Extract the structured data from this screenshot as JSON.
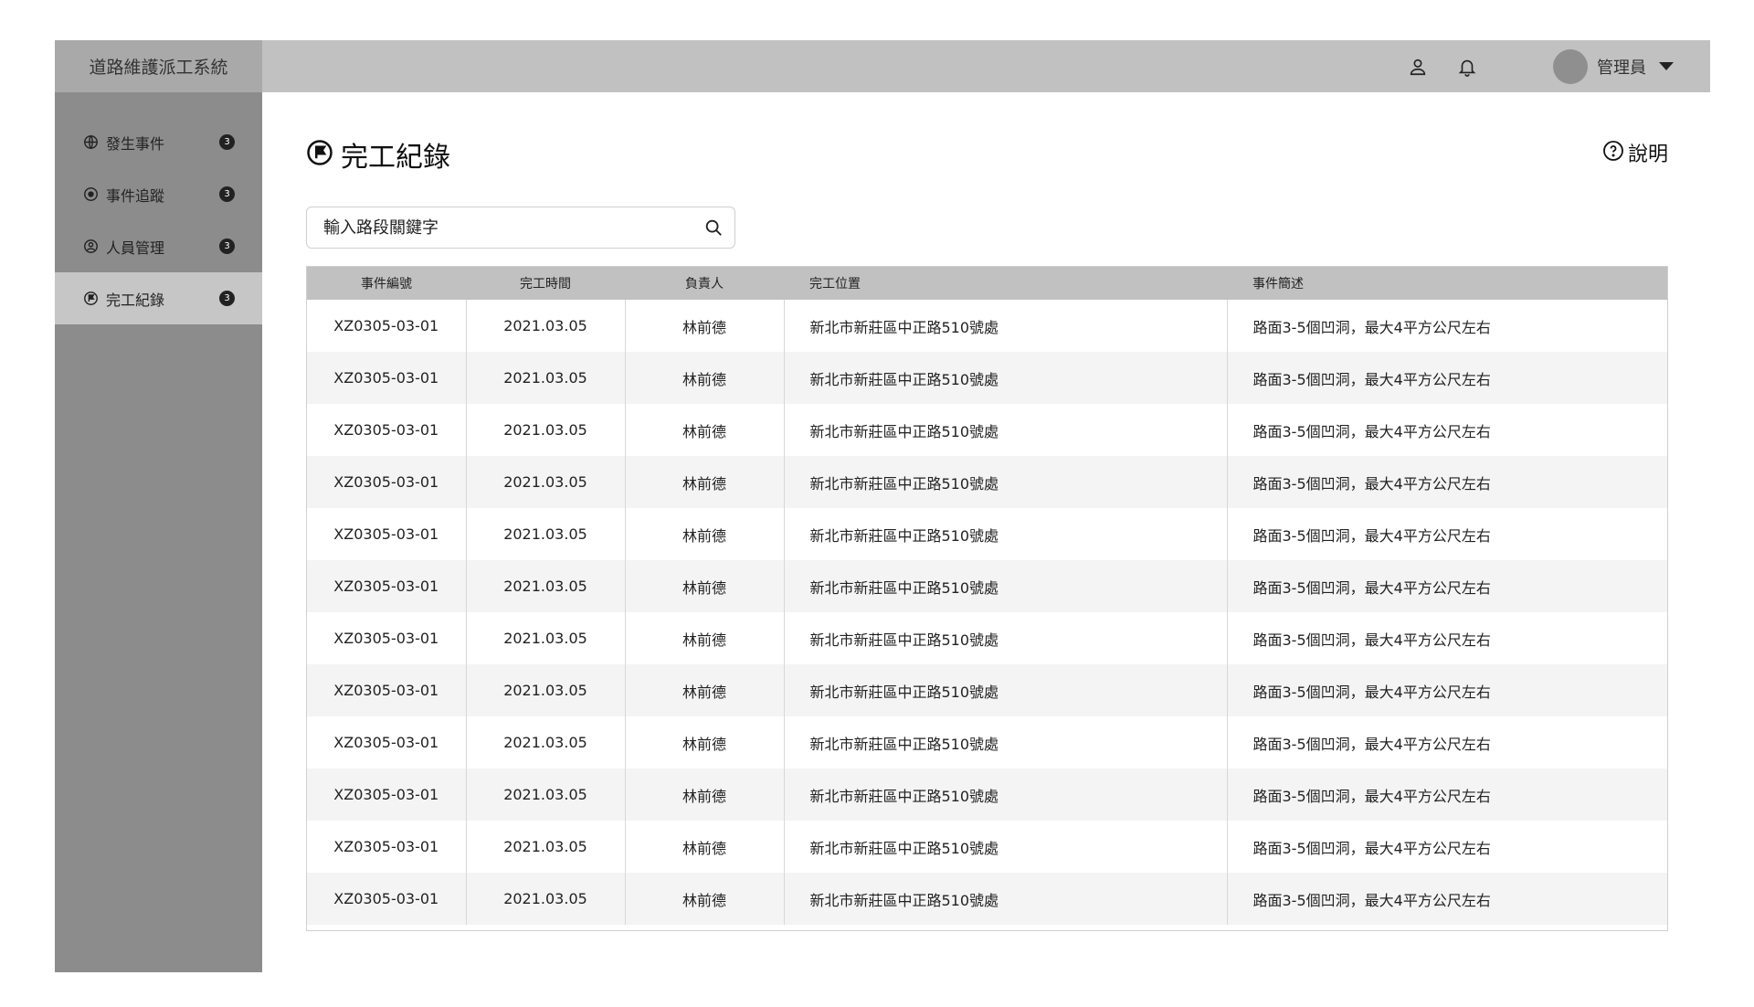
{
  "app": {
    "title": "道路維護派工系統"
  },
  "header": {
    "user_name": "管理員",
    "icons": [
      "user-icon",
      "bell-icon",
      "chevron-down-icon"
    ]
  },
  "sidebar": {
    "items": [
      {
        "label": "發生事件",
        "badge": "3",
        "icon": "globe-icon",
        "active": false
      },
      {
        "label": "事件追蹤",
        "badge": "3",
        "icon": "eye-icon",
        "active": false
      },
      {
        "label": "人員管理",
        "badge": "3",
        "icon": "person-circle-icon",
        "active": false
      },
      {
        "label": "完工紀錄",
        "badge": "3",
        "icon": "flag-circle-icon",
        "active": true
      }
    ]
  },
  "page": {
    "title": "完工紀錄",
    "help_label": "說明"
  },
  "search": {
    "placeholder": "輸入路段關鍵字"
  },
  "table": {
    "columns": [
      "事件編號",
      "完工時間",
      "負責人",
      "完工位置",
      "事件簡述"
    ],
    "rows": [
      [
        "XZ0305-03-01",
        "2021.03.05",
        "林前德",
        "新北市新莊區中正路510號處",
        "路面3-5個凹洞，最大4平方公尺左右"
      ],
      [
        "XZ0305-03-01",
        "2021.03.05",
        "林前德",
        "新北市新莊區中正路510號處",
        "路面3-5個凹洞，最大4平方公尺左右"
      ],
      [
        "XZ0305-03-01",
        "2021.03.05",
        "林前德",
        "新北市新莊區中正路510號處",
        "路面3-5個凹洞，最大4平方公尺左右"
      ],
      [
        "XZ0305-03-01",
        "2021.03.05",
        "林前德",
        "新北市新莊區中正路510號處",
        "路面3-5個凹洞，最大4平方公尺左右"
      ],
      [
        "XZ0305-03-01",
        "2021.03.05",
        "林前德",
        "新北市新莊區中正路510號處",
        "路面3-5個凹洞，最大4平方公尺左右"
      ],
      [
        "XZ0305-03-01",
        "2021.03.05",
        "林前德",
        "新北市新莊區中正路510號處",
        "路面3-5個凹洞，最大4平方公尺左右"
      ],
      [
        "XZ0305-03-01",
        "2021.03.05",
        "林前德",
        "新北市新莊區中正路510號處",
        "路面3-5個凹洞，最大4平方公尺左右"
      ],
      [
        "XZ0305-03-01",
        "2021.03.05",
        "林前德",
        "新北市新莊區中正路510號處",
        "路面3-5個凹洞，最大4平方公尺左右"
      ],
      [
        "XZ0305-03-01",
        "2021.03.05",
        "林前德",
        "新北市新莊區中正路510號處",
        "路面3-5個凹洞，最大4平方公尺左右"
      ],
      [
        "XZ0305-03-01",
        "2021.03.05",
        "林前德",
        "新北市新莊區中正路510號處",
        "路面3-5個凹洞，最大4平方公尺左右"
      ],
      [
        "XZ0305-03-01",
        "2021.03.05",
        "林前德",
        "新北市新莊區中正路510號處",
        "路面3-5個凹洞，最大4平方公尺左右"
      ],
      [
        "XZ0305-03-01",
        "2021.03.05",
        "林前德",
        "新北市新莊區中正路510號處",
        "路面3-5個凹洞，最大4平方公尺左右"
      ]
    ]
  },
  "colors": {
    "topbar": "#c1c1c1",
    "brand": "#a9a9a9",
    "sidebar": "#8c8c8c",
    "active_item": "#c6c6c6",
    "table_header": "#c1c1c1"
  }
}
